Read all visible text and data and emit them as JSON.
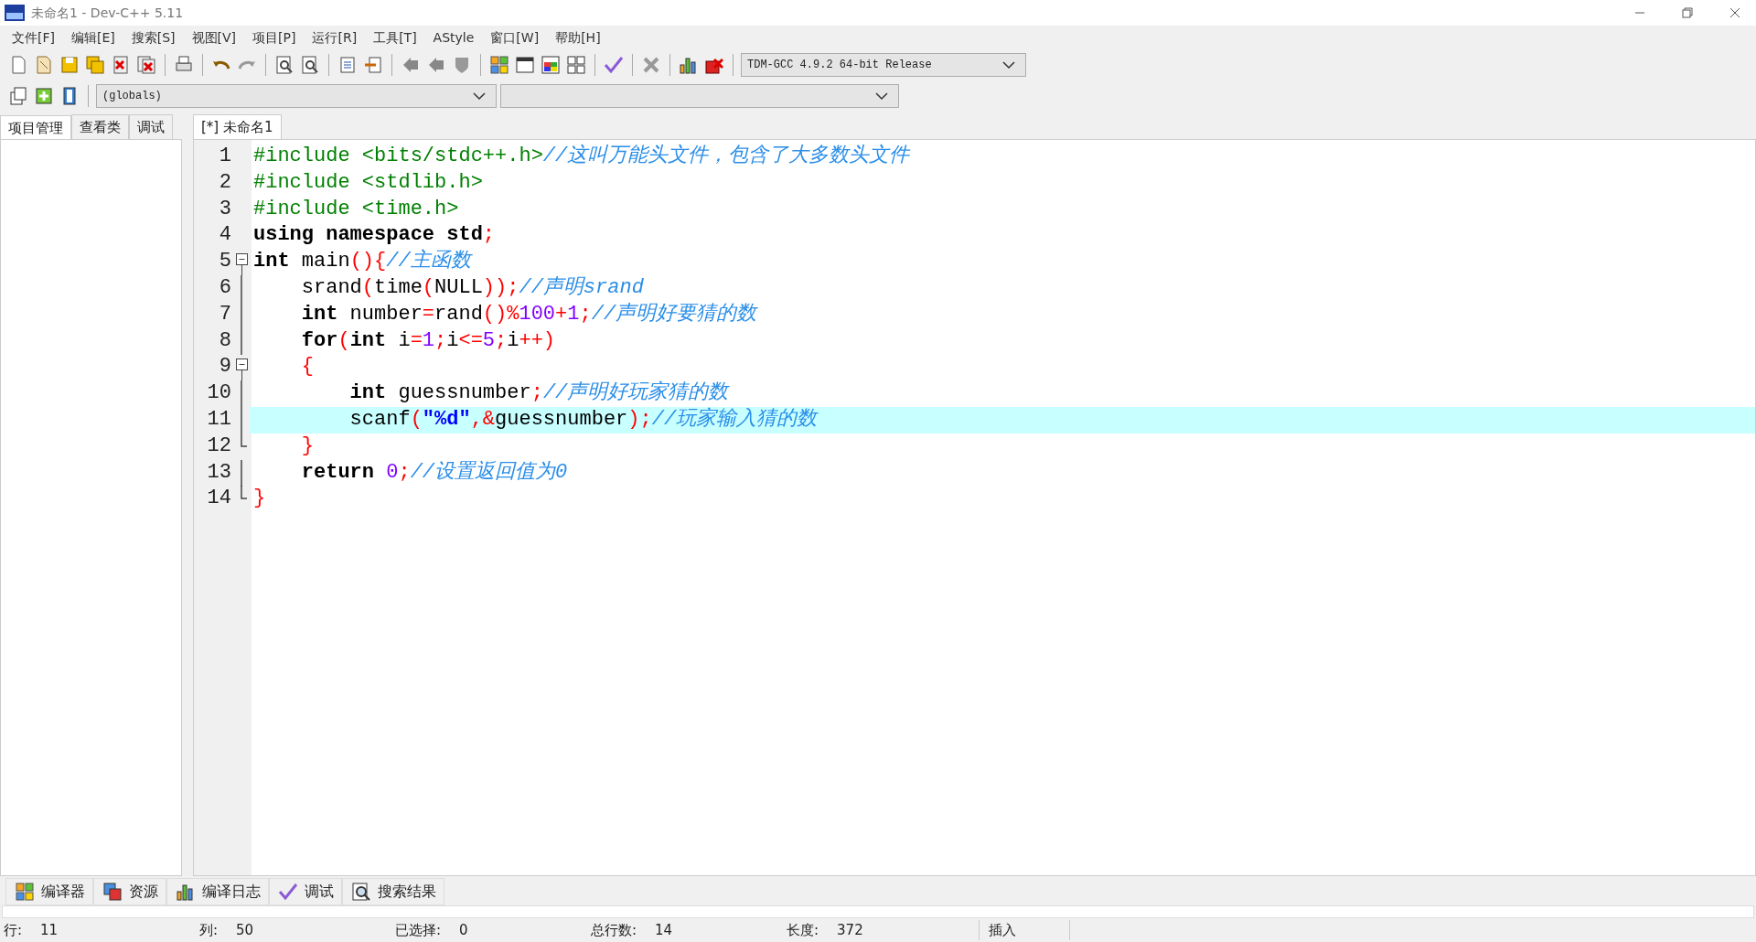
{
  "window": {
    "title": "未命名1 - Dev-C++ 5.11"
  },
  "menu": [
    "文件[F]",
    "编辑[E]",
    "搜索[S]",
    "视图[V]",
    "项目[P]",
    "运行[R]",
    "工具[T]",
    "AStyle",
    "窗口[W]",
    "帮助[H]"
  ],
  "compiler_select": {
    "value": "TDM-GCC 4.9.2 64-bit Release"
  },
  "scope_select": {
    "value": "(globals)"
  },
  "sidebar_tabs": [
    {
      "label": "项目管理",
      "selected": true
    },
    {
      "label": "查看类",
      "selected": false
    },
    {
      "label": "调试",
      "selected": false
    }
  ],
  "editor_tabs": [
    {
      "label": "[*] 未命名1",
      "selected": true
    }
  ],
  "code_lines": [
    {
      "number": "1",
      "kind": "plain",
      "current": false,
      "tokens": [
        {
          "kind": "pre",
          "text": "#include <bits/stdc++.h>"
        },
        {
          "kind": "comment",
          "text": "//这叫万能头文件，包含了大多数头文件"
        }
      ]
    },
    {
      "number": "2",
      "kind": "plain",
      "current": false,
      "tokens": [
        {
          "kind": "pre",
          "text": "#include <stdlib.h>"
        }
      ]
    },
    {
      "number": "3",
      "kind": "plain",
      "current": false,
      "tokens": [
        {
          "kind": "pre",
          "text": "#include <time.h>"
        }
      ]
    },
    {
      "number": "4",
      "kind": "plain",
      "current": false,
      "tokens": [
        {
          "kind": "kw",
          "text": "using namespace std"
        },
        {
          "kind": "sym",
          "text": ";"
        }
      ]
    },
    {
      "number": "5",
      "kind": "fold_start",
      "current": false,
      "tokens": [
        {
          "kind": "kw",
          "text": "int"
        },
        {
          "kind": "plain",
          "text": " main"
        },
        {
          "kind": "sym",
          "text": "(){"
        },
        {
          "kind": "comment",
          "text": "//主函数"
        }
      ]
    },
    {
      "number": "6",
      "kind": "fold_body",
      "current": false,
      "tokens": [
        {
          "kind": "plain",
          "text": "    srand"
        },
        {
          "kind": "sym",
          "text": "("
        },
        {
          "kind": "plain",
          "text": "time"
        },
        {
          "kind": "sym",
          "text": "("
        },
        {
          "kind": "plain",
          "text": "NULL"
        },
        {
          "kind": "sym",
          "text": "));"
        },
        {
          "kind": "comment",
          "text": "//声明srand"
        }
      ]
    },
    {
      "number": "7",
      "kind": "fold_body",
      "current": false,
      "tokens": [
        {
          "kind": "kw",
          "text": "    int"
        },
        {
          "kind": "plain",
          "text": " number"
        },
        {
          "kind": "sym",
          "text": "="
        },
        {
          "kind": "plain",
          "text": "rand"
        },
        {
          "kind": "sym",
          "text": "()%"
        },
        {
          "kind": "num",
          "text": "100"
        },
        {
          "kind": "sym",
          "text": "+"
        },
        {
          "kind": "num",
          "text": "1"
        },
        {
          "kind": "sym",
          "text": ";"
        },
        {
          "kind": "comment",
          "text": "//声明好要猜的数"
        }
      ]
    },
    {
      "number": "8",
      "kind": "fold_body",
      "current": false,
      "tokens": [
        {
          "kind": "kw",
          "text": "    for"
        },
        {
          "kind": "sym",
          "text": "("
        },
        {
          "kind": "kw",
          "text": "int"
        },
        {
          "kind": "plain",
          "text": " i"
        },
        {
          "kind": "sym",
          "text": "="
        },
        {
          "kind": "num",
          "text": "1"
        },
        {
          "kind": "sym",
          "text": ";"
        },
        {
          "kind": "plain",
          "text": "i"
        },
        {
          "kind": "sym",
          "text": "<="
        },
        {
          "kind": "num",
          "text": "5"
        },
        {
          "kind": "sym",
          "text": ";"
        },
        {
          "kind": "plain",
          "text": "i"
        },
        {
          "kind": "sym",
          "text": "++)"
        }
      ]
    },
    {
      "number": "9",
      "kind": "fold_start",
      "current": false,
      "tokens": [
        {
          "kind": "sym",
          "text": "    {"
        }
      ]
    },
    {
      "number": "10",
      "kind": "fold_body",
      "current": false,
      "tokens": [
        {
          "kind": "kw",
          "text": "        int"
        },
        {
          "kind": "plain",
          "text": " guessnumber"
        },
        {
          "kind": "sym",
          "text": ";"
        },
        {
          "kind": "comment",
          "text": "//声明好玩家猜的数"
        }
      ]
    },
    {
      "number": "11",
      "kind": "fold_body",
      "current": true,
      "tokens": [
        {
          "kind": "plain",
          "text": "        scanf"
        },
        {
          "kind": "sym",
          "text": "("
        },
        {
          "kind": "str",
          "text": "\"%d\""
        },
        {
          "kind": "sym",
          "text": ",&"
        },
        {
          "kind": "plain",
          "text": "guessnumber"
        },
        {
          "kind": "sym",
          "text": ");"
        },
        {
          "kind": "comment",
          "text": "//玩家输入猜的数"
        }
      ]
    },
    {
      "number": "12",
      "kind": "fold_end",
      "current": false,
      "tokens": [
        {
          "kind": "sym",
          "text": "    }"
        }
      ]
    },
    {
      "number": "13",
      "kind": "fold_body",
      "current": false,
      "tokens": [
        {
          "kind": "kw",
          "text": "    return "
        },
        {
          "kind": "num",
          "text": "0"
        },
        {
          "kind": "sym",
          "text": ";"
        },
        {
          "kind": "comment",
          "text": "//设置返回值为0"
        }
      ]
    },
    {
      "number": "14",
      "kind": "fold_end",
      "current": false,
      "tokens": [
        {
          "kind": "sym",
          "text": "}"
        }
      ]
    }
  ],
  "bottom_tabs": [
    {
      "label": "编译器"
    },
    {
      "label": "资源"
    },
    {
      "label": "编译日志"
    },
    {
      "label": "调试"
    },
    {
      "label": "搜索结果"
    }
  ],
  "status_bar": [
    {
      "label": "行:",
      "value": "11"
    },
    {
      "label": "列:",
      "value": "50"
    },
    {
      "label": "已选择:",
      "value": "0"
    },
    {
      "label": "总行数:",
      "value": "14"
    },
    {
      "label": "长度:",
      "value": "372"
    },
    {
      "label": "插入"
    }
  ]
}
